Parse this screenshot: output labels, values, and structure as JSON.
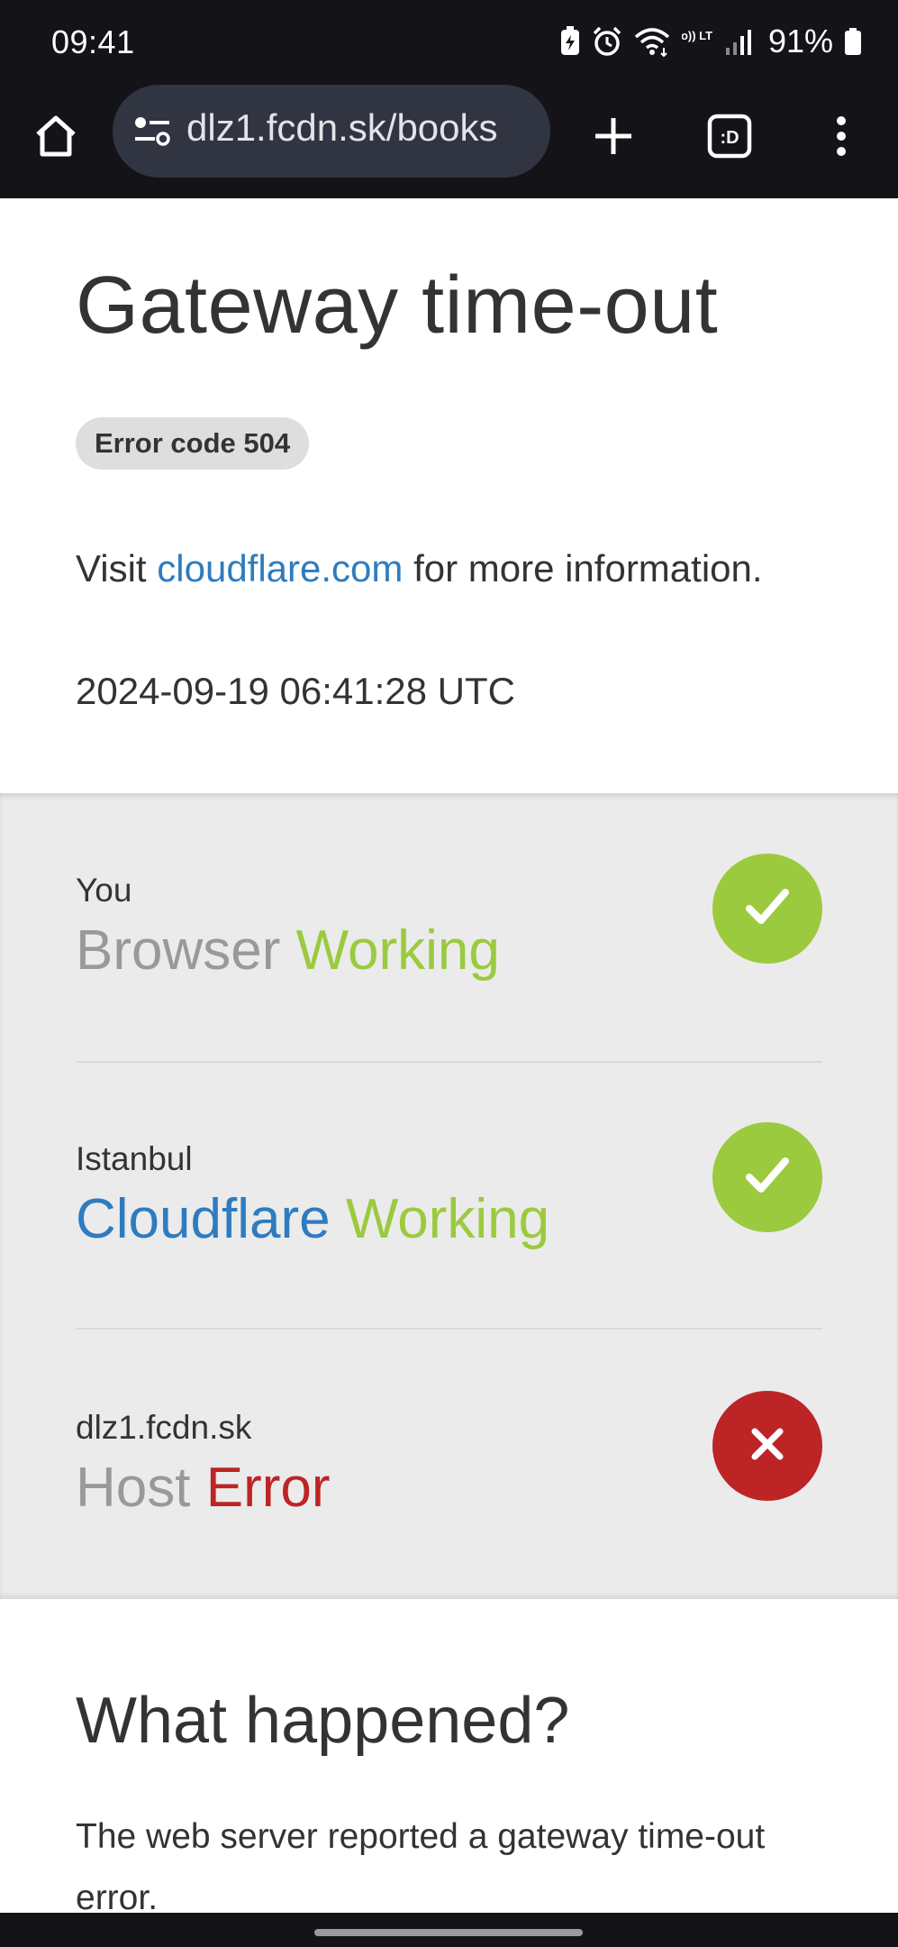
{
  "status_bar": {
    "time": "09:41",
    "battery_percent": "91%",
    "icons": [
      "battery-saver-icon",
      "alarm-icon",
      "wifi-icon",
      "volte-icon",
      "signal-icon",
      "battery-icon"
    ],
    "volte_label": "Vo)) LTE"
  },
  "browser": {
    "url": "dlz1.fcdn.sk/books",
    "tab_switcher_label": ":D",
    "icons": [
      "home-icon",
      "site-settings-icon",
      "plus-icon",
      "tab-switcher-icon",
      "more-vert-icon"
    ]
  },
  "error": {
    "title": "Gateway time-out",
    "code_badge": "Error code 504",
    "visit_prefix": "Visit",
    "visit_link": "cloudflare.com",
    "visit_suffix": "for more information.",
    "timestamp": "2024-09-19 06:41:28 UTC"
  },
  "status_rows": [
    {
      "location": "You",
      "name": "Browser",
      "state": "Working",
      "result": "ok",
      "icon": "check-icon"
    },
    {
      "location": "Istanbul",
      "name": "Cloudflare",
      "state": "Working",
      "result": "ok",
      "icon": "check-icon"
    },
    {
      "location": "dlz1.fcdn.sk",
      "name": "Host",
      "state": "Error",
      "result": "error",
      "icon": "x-icon"
    }
  ],
  "what_happened": {
    "title": "What happened?",
    "text": "The web server reported a gateway time-out error."
  },
  "colors": {
    "working_green": "#9bca3e",
    "error_red": "#bd2426",
    "link_blue": "#2f7bbf",
    "panel_grey": "#ebebeb",
    "chrome_dark": "#141418"
  }
}
